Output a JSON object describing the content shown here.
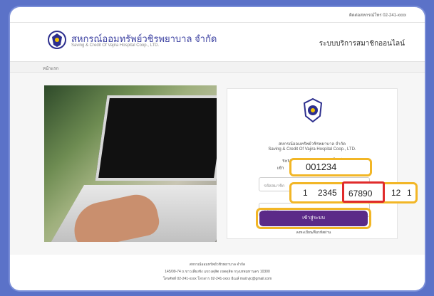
{
  "contact": "ติดต่อสหกรณ์โทร 02-241-xxxx",
  "brand": {
    "name_th": "สหกรณ์ออมทรัพย์วชิรพยาบาล จำกัด",
    "name_en": "Saving & Credit Of Vajira Hospital Coop., LTD."
  },
  "system_title": "ระบบบริการสมาชิกออนไลน์",
  "breadcrumb": "หน้าแรก",
  "login": {
    "org_th": "สหกรณ์ออมทรัพย์วชิรพยาบาล จำกัด",
    "org_en": "Saving & Credit Of Vajira Hospital Coop., LTD.",
    "title": "ระบบบริการสมาชิกออนไลน์",
    "subtitle": "เข้า",
    "member_placeholder": "รหัสสมาชิก",
    "password_placeholder": "รหัสผ่าน",
    "member_value": "001234",
    "password_parts": [
      "1",
      "2345",
      "67890",
      "12",
      "1"
    ],
    "button_label": "เข้าสู่ระบบ",
    "forgot_link": "ลงทะเบียน/ลืมรหัสผ่าน"
  },
  "footer": {
    "line1": "สหกรณ์ออมทรัพย์วชิรพยาบาล จำกัด",
    "line2": "145/09-74 ถ.ขาวเลี่ยงชัง แขวงดุสิต เขตดุสิต กรุงเทพมหานคร 10300",
    "line3": "โทรศัพท์ 02-241-xxxx โทรสาร 02-241-xxxx อีเมล์ mail.vjc@gmail.com"
  },
  "colors": {
    "background": "#5b72c8",
    "accent_button": "#5b2a88",
    "highlight_yellow": "#f2b626",
    "highlight_red": "#e02b2b"
  }
}
